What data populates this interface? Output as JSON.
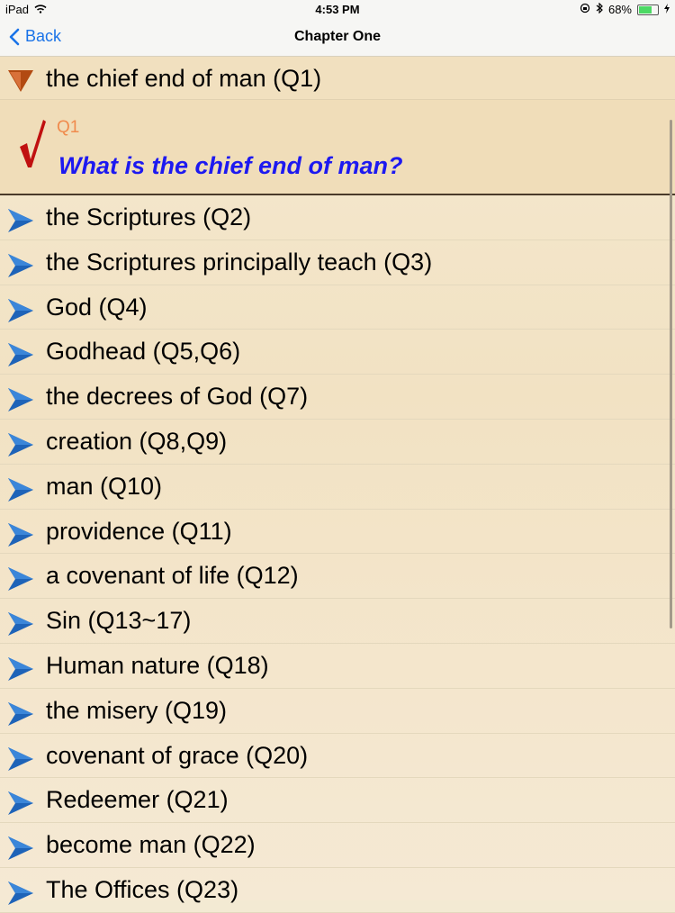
{
  "status": {
    "device": "iPad",
    "time": "4:53 PM",
    "battery": "68%",
    "battery_level": 0.68
  },
  "nav": {
    "back_label": "Back",
    "title": "Chapter One"
  },
  "expanded": {
    "label": "the chief end of man (Q1)",
    "qnum": "Q1",
    "question": "What is the chief end of man?"
  },
  "items": [
    {
      "label": "the Scriptures (Q2)"
    },
    {
      "label": "the Scriptures principally teach (Q3)"
    },
    {
      "label": "God (Q4)"
    },
    {
      "label": "Godhead (Q5,Q6)"
    },
    {
      "label": "the decrees of God (Q7)"
    },
    {
      "label": "creation (Q8,Q9)"
    },
    {
      "label": "man (Q10)"
    },
    {
      "label": "providence (Q11)"
    },
    {
      "label": "a covenant of life (Q12)"
    },
    {
      "label": "Sin (Q13~17)"
    },
    {
      "label": "Human nature (Q18)"
    },
    {
      "label": "the misery (Q19)"
    },
    {
      "label": "covenant of grace (Q20)"
    },
    {
      "label": "Redeemer (Q21)"
    },
    {
      "label": "become man (Q22)"
    },
    {
      "label": "The Offices (Q23)"
    }
  ],
  "colors": {
    "accent": "#1a73e8",
    "question": "#1d19f0",
    "qnum": "#f08b4d",
    "arrow": "#1e63b8",
    "expanded_arrow": "#b24a12",
    "check": "#c01010"
  }
}
